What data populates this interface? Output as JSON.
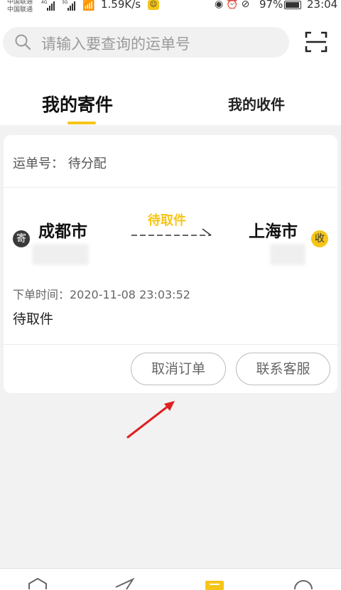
{
  "status_bar": {
    "carrier_1": "中国联通",
    "carrier_2": "中国联通",
    "net_1": "4G",
    "net_2": "3G",
    "speed": "1.59K/s",
    "battery": "97%",
    "battery_level": 0.97,
    "time": "23:04",
    "icons": [
      "eye-icon",
      "alarm-icon",
      "bell-off-icon"
    ]
  },
  "search": {
    "placeholder": "请输入要查询的运单号",
    "icon": "search-icon",
    "scan_icon": "scan-icon"
  },
  "tabs": [
    {
      "label": "我的寄件",
      "active": true
    },
    {
      "label": "我的收件",
      "active": false
    }
  ],
  "order": {
    "tracking_label": "运单号： 待分配",
    "send_badge": "寄",
    "receive_badge": "收",
    "from_city": "成都市",
    "to_city": "上海市",
    "route_status": "待取件",
    "order_time": "下单时间：2020-11-08 23:03:52",
    "status": "待取件",
    "buttons": {
      "cancel": "取消订单",
      "contact": "联系客服"
    }
  },
  "colors": {
    "accent": "#f5c518",
    "annotation_arrow": "#e02020"
  },
  "bottom_nav": [
    "home-icon",
    "send-icon",
    "orders-icon",
    "chat-icon"
  ]
}
